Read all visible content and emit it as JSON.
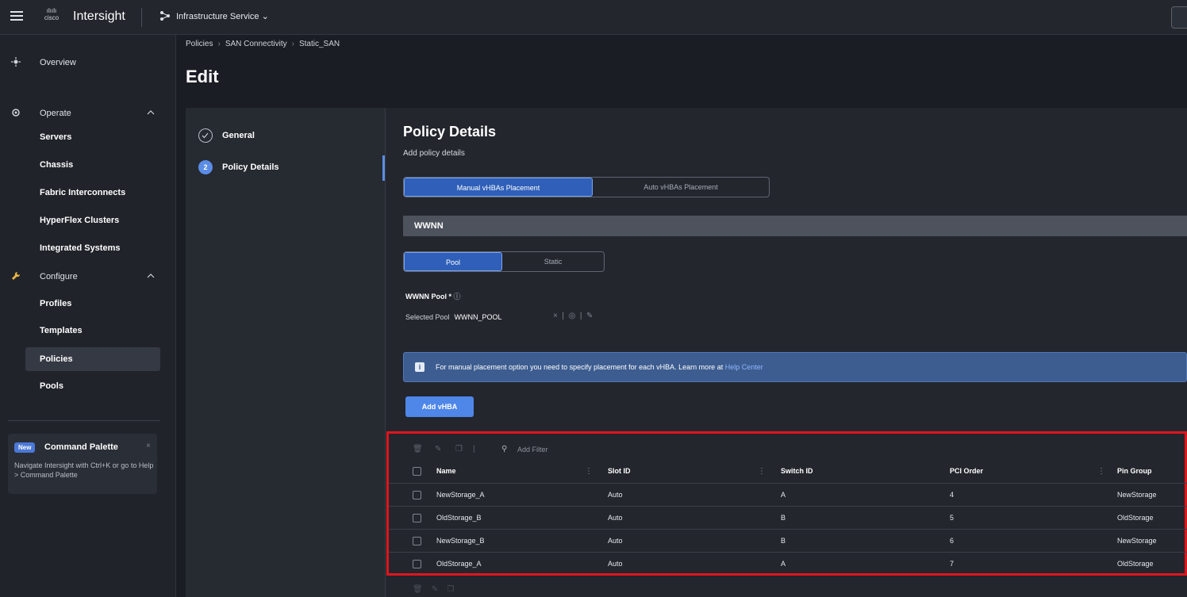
{
  "topbar": {
    "brand_line1": "ılıılı",
    "brand_line2": "cisco",
    "app_name": "Intersight",
    "service": "Infrastructure Service"
  },
  "sidebar": {
    "items": [
      {
        "label": "Overview",
        "icon": "overview-icon"
      },
      {
        "label": "Operate",
        "icon": "operate-icon",
        "expanded": true
      },
      {
        "label": "Servers"
      },
      {
        "label": "Chassis"
      },
      {
        "label": "Fabric Interconnects"
      },
      {
        "label": "HyperFlex Clusters"
      },
      {
        "label": "Integrated Systems"
      },
      {
        "label": "Configure",
        "icon": "configure-icon",
        "expanded": true
      },
      {
        "label": "Profiles"
      },
      {
        "label": "Templates"
      },
      {
        "label": "Policies",
        "active": true
      },
      {
        "label": "Pools"
      }
    ],
    "command_palette": {
      "badge": "New",
      "title": "Command Palette",
      "description": "Navigate Intersight with Ctrl+K or go to Help > Command Palette"
    }
  },
  "breadcrumb": [
    "Policies",
    "SAN Connectivity",
    "Static_SAN"
  ],
  "page_title": "Edit",
  "steps": [
    {
      "label": "General",
      "state": "done"
    },
    {
      "number": "2",
      "label": "Policy Details",
      "state": "active"
    }
  ],
  "details": {
    "title": "Policy Details",
    "subtitle": "Add policy details",
    "placement_options": [
      "Manual vHBAs Placement",
      "Auto vHBAs Placement"
    ],
    "placement_selected": "Manual vHBAs Placement",
    "section": "WWNN",
    "wwnn_options": [
      "Pool",
      "Static"
    ],
    "wwnn_selected": "Pool",
    "pool_label": "WWNN Pool *",
    "selected_pool_label": "Selected Pool",
    "selected_pool_value": "WWNN_POOL",
    "banner_text": "For manual placement option you need to specify placement for each vHBA. Learn more at ",
    "banner_link": "Help Center",
    "add_button": "Add vHBA"
  },
  "table": {
    "filter_placeholder": "Add Filter",
    "columns": [
      "Name",
      "Slot ID",
      "Switch ID",
      "PCI Order",
      "Pin Group"
    ],
    "rows": [
      {
        "name": "NewStorage_A",
        "slot": "Auto",
        "switch": "A",
        "pci": "4",
        "pin": "NewStorage"
      },
      {
        "name": "OldStorage_B",
        "slot": "Auto",
        "switch": "B",
        "pci": "5",
        "pin": "OldStorage"
      },
      {
        "name": "NewStorage_B",
        "slot": "Auto",
        "switch": "B",
        "pci": "6",
        "pin": "NewStorage"
      },
      {
        "name": "OldStorage_A",
        "slot": "Auto",
        "switch": "A",
        "pci": "7",
        "pin": "OldStorage"
      }
    ]
  },
  "colors": {
    "accent": "#4f87e8",
    "highlight": "#e0141e",
    "background": "#1a1d24"
  }
}
